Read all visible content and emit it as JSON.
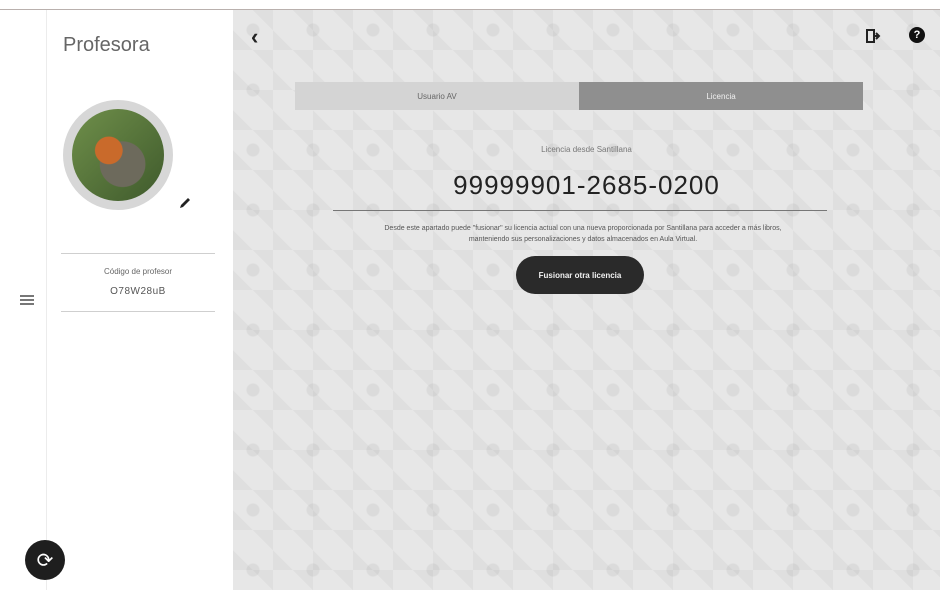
{
  "sidebar": {
    "title": "Profesora",
    "code_label": "Código de profesor",
    "code_value": "O78W28uB"
  },
  "tabs": [
    {
      "label": "Usuario AV",
      "active": false
    },
    {
      "label": "Licencia",
      "active": true
    }
  ],
  "license": {
    "label": "Licencia desde Santillana",
    "number": "99999901-2685-0200",
    "description": "Desde este apartado puede \"fusionar\" su licencia actual con una nueva proporcionada por Santillana para acceder a más libros, manteniendo sus personalizaciones y datos almacenados en Aula Virtual.",
    "button_label": "Fusionar otra licencia"
  },
  "icons": {
    "back": "chevron-left-icon",
    "logout": "logout-icon",
    "help": "help-icon",
    "menu": "hamburger-menu-icon",
    "edit": "pencil-icon",
    "sync": "sync-icon"
  }
}
